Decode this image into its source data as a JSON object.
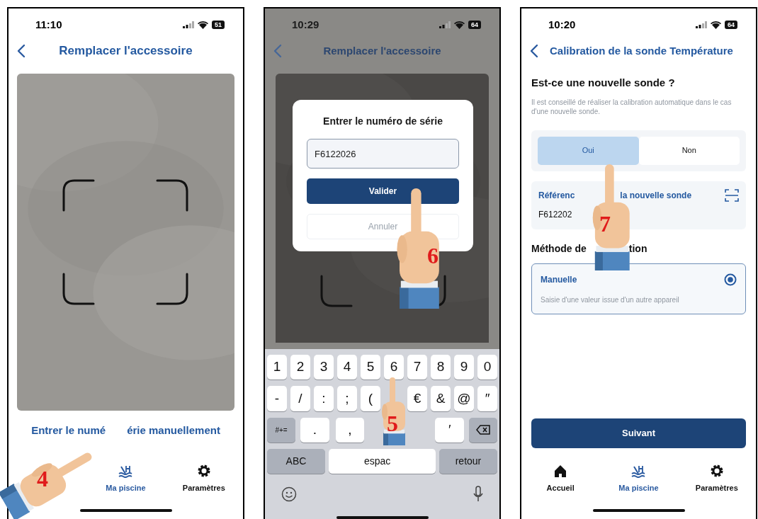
{
  "screens": [
    {
      "kind": "scanner",
      "time": "11:10",
      "battery": "51",
      "title": "Remplacer l'accessoire",
      "manual_link": [
        "Entrer le numé",
        "érie manuellement"
      ],
      "nav": [
        {
          "kind": "pool",
          "label": "Ma piscine",
          "selected": true
        },
        {
          "kind": "settings",
          "label": "Paramètres",
          "selected": false
        }
      ],
      "hands": [
        {
          "number": "4"
        }
      ]
    },
    {
      "kind": "serial_dialog",
      "time": "10:29",
      "battery": "64",
      "title": "Remplacer l'accessoire",
      "dialog": {
        "title": "Entrer le numéro de série",
        "value": "F6122026",
        "confirm": "Valider",
        "cancel": "Annuler"
      },
      "keyboard": [
        [
          "1",
          "2",
          "3",
          "4",
          "5",
          "6",
          "7",
          "8",
          "9",
          "0"
        ],
        [
          "-",
          "/",
          ":",
          ";",
          "(",
          {
            "kind": "blank"
          },
          "€",
          "&",
          "@",
          "″"
        ],
        [
          {
            "kind": "func",
            "label": "#+="
          },
          ".",
          ",",
          {
            "kind": "blank"
          },
          {
            "kind": "blank"
          },
          "′",
          {
            "kind": "delete"
          }
        ],
        [
          {
            "kind": "func",
            "label": "ABC"
          },
          {
            "kind": "space",
            "label": "espac"
          },
          {
            "kind": "func",
            "label": "retour"
          }
        ]
      ],
      "hands": [
        {
          "number": "6"
        },
        {
          "number": "5"
        }
      ]
    },
    {
      "kind": "calibration",
      "time": "10:20",
      "battery": "64",
      "title": "Calibration de la sonde Température",
      "question": "Est-ce une nouvelle sonde ?",
      "hint": "Il est conseillé de réaliser la calibration automatique dans le cas d'une nouvelle sonde.",
      "choices": [
        {
          "label": "Oui",
          "selected": true
        },
        {
          "label": "Non",
          "selected": false
        }
      ],
      "reference": {
        "label": [
          "Référenc",
          "la nouvelle sonde"
        ],
        "value": "F612202"
      },
      "method_heading": [
        "Méthode de",
        "tion"
      ],
      "methods": [
        {
          "label": "Manuelle",
          "description": "Saisie d'une valeur issue d'un autre appareil",
          "selected": true
        }
      ],
      "next": "Suivant",
      "nav": [
        {
          "kind": "home",
          "label": "Accueil",
          "selected": false
        },
        {
          "kind": "pool",
          "label": "Ma piscine",
          "selected": true
        },
        {
          "kind": "settings",
          "label": "Paramètres",
          "selected": false
        }
      ],
      "hands": [
        {
          "number": "7"
        }
      ]
    }
  ]
}
